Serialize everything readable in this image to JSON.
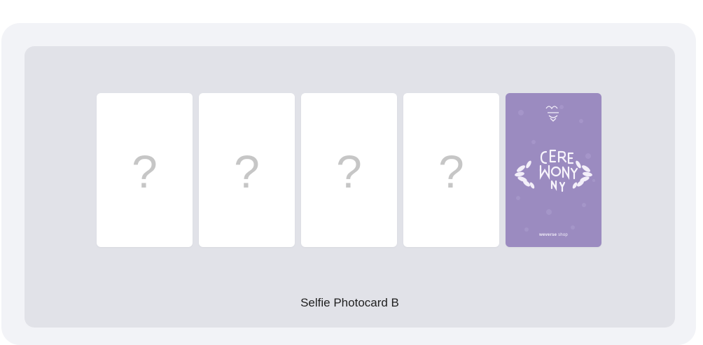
{
  "photocard_set": {
    "label": "Selfie Photocard B",
    "cards": [
      {
        "state": "hidden",
        "symbol": "?"
      },
      {
        "state": "hidden",
        "symbol": "?"
      },
      {
        "state": "hidden",
        "symbol": "?"
      },
      {
        "state": "hidden",
        "symbol": "?"
      },
      {
        "state": "revealed",
        "symbol": ""
      }
    ],
    "revealed_card": {
      "background_color": "#9b8bc0",
      "logo_text": "CEREMONY",
      "footer_brand": "weverse",
      "footer_suffix": "shop"
    }
  },
  "colors": {
    "outer_frame": "#f2f3f7",
    "inner_panel": "#e1e2e8",
    "question_mark": "#c6c6c6"
  }
}
